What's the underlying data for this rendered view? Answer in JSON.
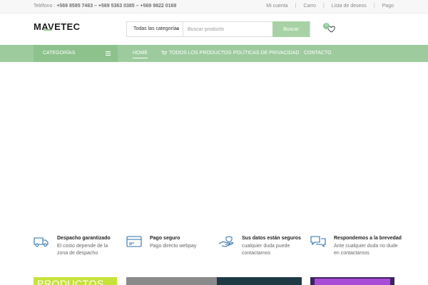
{
  "topbar": {
    "phone_label": "Teléfono :",
    "phones": "+569 8595 7463 – +569 5363 0385 – +569 9822 0169",
    "links": [
      "Mi cuenta",
      "Carro",
      "Lista de deseos",
      "Pago"
    ],
    "separator": "|"
  },
  "header": {
    "logo_text": "MAVETEC",
    "search": {
      "category": "Todas las categorías",
      "placeholder": "Buscar producto",
      "button": "Buscar"
    },
    "cart_count": "0"
  },
  "nav": {
    "categories_label": "CATEGORÍAS",
    "items": [
      "HOME",
      "TODOS LOS PRODUCTOS",
      "POLÍTICAS DE PRIVACIDAD",
      "CONTACTO"
    ]
  },
  "features": [
    {
      "icon": "delivery-truck-icon",
      "title": "Despacho garantizado",
      "desc": "El costo depende de la zona de despacho"
    },
    {
      "icon": "credit-card-icon",
      "title": "Pago seguro",
      "desc": "Pago directo webpay"
    },
    {
      "icon": "hand-shield-icon",
      "title": "Sus datos están seguros",
      "desc": "cualquier duda puede contactarnos"
    },
    {
      "icon": "chat-bubbles-icon",
      "title": "Respondemos a la brevedad",
      "desc": "Ante cualquier duda no dude en contactarnos"
    }
  ],
  "banners": {
    "first_text": "PRODUCTOS"
  },
  "colors": {
    "accent": "#9dcb9e",
    "accent_dark": "#8dc28d",
    "icon_blue": "#2f6fa8"
  }
}
